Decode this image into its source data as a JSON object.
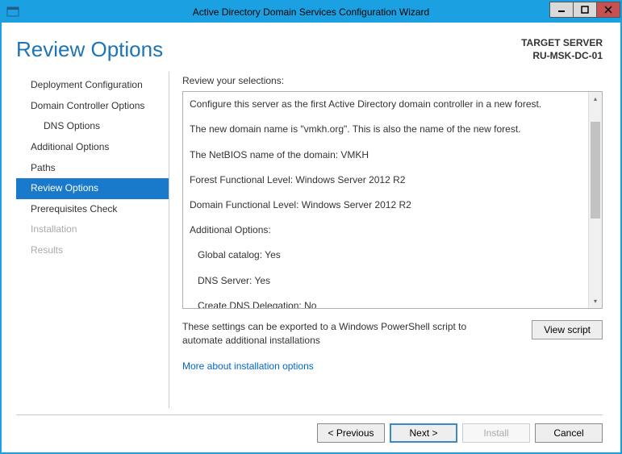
{
  "titlebar": {
    "title": "Active Directory Domain Services Configuration Wizard"
  },
  "header": {
    "page_title": "Review Options",
    "target_label": "TARGET SERVER",
    "target_server": "RU-MSK-DC-01"
  },
  "nav": {
    "items": [
      {
        "label": "Deployment Configuration",
        "indent": false,
        "selected": false,
        "disabled": false
      },
      {
        "label": "Domain Controller Options",
        "indent": false,
        "selected": false,
        "disabled": false
      },
      {
        "label": "DNS Options",
        "indent": true,
        "selected": false,
        "disabled": false
      },
      {
        "label": "Additional Options",
        "indent": false,
        "selected": false,
        "disabled": false
      },
      {
        "label": "Paths",
        "indent": false,
        "selected": false,
        "disabled": false
      },
      {
        "label": "Review Options",
        "indent": false,
        "selected": true,
        "disabled": false
      },
      {
        "label": "Prerequisites Check",
        "indent": false,
        "selected": false,
        "disabled": false
      },
      {
        "label": "Installation",
        "indent": false,
        "selected": false,
        "disabled": true
      },
      {
        "label": "Results",
        "indent": false,
        "selected": false,
        "disabled": true
      }
    ]
  },
  "main": {
    "review_label": "Review your selections:",
    "review_lines": {
      "l0": "Configure this server as the first Active Directory domain controller in a new forest.",
      "l1": "The new domain name is \"vmkh.org\". This is also the name of the new forest.",
      "l2": "The NetBIOS name of the domain: VMKH",
      "l3": "Forest Functional Level: Windows Server 2012 R2",
      "l4": "Domain Functional Level: Windows Server 2012 R2",
      "l5": "Additional Options:",
      "l6": "Global catalog: Yes",
      "l7": "DNS Server: Yes",
      "l8": "Create DNS Delegation: No"
    },
    "export_text": "These settings can be exported to a Windows PowerShell script to automate additional installations",
    "view_script_label": "View script",
    "more_link": "More about installation options"
  },
  "footer": {
    "previous": "< Previous",
    "next": "Next >",
    "install": "Install",
    "cancel": "Cancel"
  }
}
